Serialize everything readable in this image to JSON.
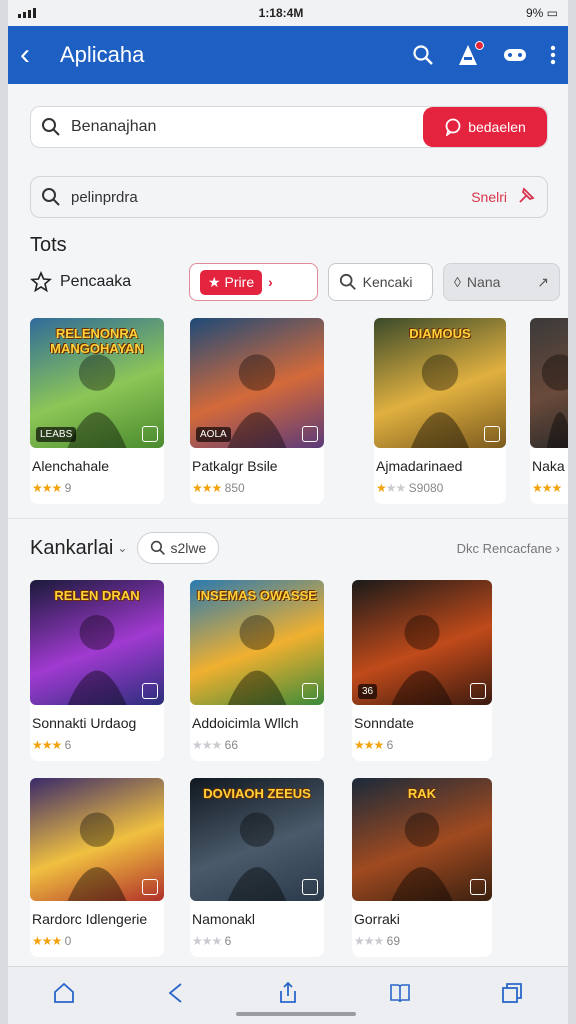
{
  "status": {
    "time": "1:18:4M",
    "battery": "9%"
  },
  "appbar": {
    "title": "Aplicaha"
  },
  "search_primary": {
    "value": "Benanajhan",
    "button_label": "bedaelen"
  },
  "search_secondary": {
    "value": "pelinprdra",
    "action_label": "Snelri"
  },
  "section1": {
    "heading": "Tots",
    "lead_label": "Pencaaka",
    "chip_primary": "Prire",
    "chip_secondary": "Kencaki",
    "chip_tertiary": "Nana"
  },
  "row1": [
    {
      "art_text": "RELENONRA MANGOHAYAN",
      "badge": "LEABS",
      "name": "Alenchahale",
      "rating": "9",
      "stars": 3.5
    },
    {
      "art_text": "",
      "badge": "AOLA",
      "name": "Patkalgr Bsile",
      "rating": "850",
      "stars": 2.5
    },
    {
      "art_text": "DIAMOUS",
      "badge": "",
      "name": "Ajmadarinaed",
      "rating": "S9080",
      "stars": 1
    },
    {
      "art_text": "",
      "badge": "",
      "name": "Naka",
      "rating": "",
      "stars": 3
    }
  ],
  "section2": {
    "heading": "Kankarlai",
    "chip": "s2lwe",
    "more": "Dkc Rencacfane"
  },
  "row2": [
    {
      "art_text": "RELEN DRAN",
      "badge": "",
      "name": "Sonnakti Urdaog",
      "rating": "6",
      "stars": 3
    },
    {
      "art_text": "INSEMAS OWASSE",
      "badge": "",
      "name": "Addoicimla Wllch",
      "rating": "66",
      "stars": 0
    },
    {
      "art_text": "",
      "badge": "36",
      "name": "Sonndate",
      "rating": "6",
      "stars": 3
    }
  ],
  "row3": [
    {
      "art_text": "",
      "badge": "",
      "name": "Rardorc Idlengerie",
      "rating": "0",
      "stars": 4
    },
    {
      "art_text": "DOVIAOH ZEEUS",
      "badge": "",
      "name": "Namonakl",
      "rating": "6",
      "stars": 0
    },
    {
      "art_text": "RAK",
      "badge": "",
      "name": "Gorraki",
      "rating": "69",
      "stars": 0
    }
  ],
  "colors": {
    "appbar": "#1d5fc2",
    "accent": "#e4233f",
    "star": "#f2a20c"
  }
}
